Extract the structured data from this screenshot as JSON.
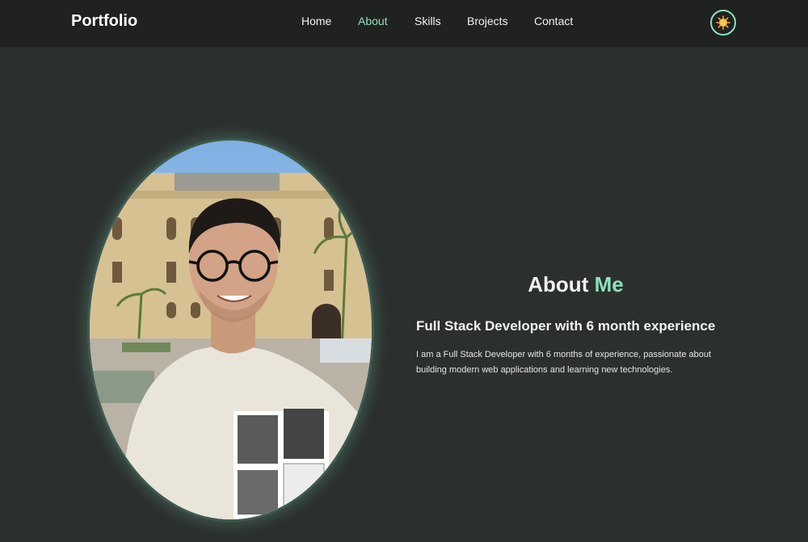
{
  "header": {
    "brand": "Portfolio",
    "nav": [
      "Home",
      "About",
      "Skills",
      "Brojects",
      "Contact"
    ],
    "active_nav": "About",
    "theme_toggle_icon": "sun-icon"
  },
  "about": {
    "title_main": "About",
    "title_accent": "Me",
    "subtitle": "Full Stack Developer with 6 month experience",
    "description": "I am a Full Stack Developer with 6 months of experience, passionate about building modern web applications and learning new technologies.",
    "photo_icon": "profile-photo"
  },
  "colors": {
    "background": "#2b302e",
    "navbar": "#1f2220",
    "accent": "#8ee0bd",
    "text": "#f2f2f2"
  }
}
